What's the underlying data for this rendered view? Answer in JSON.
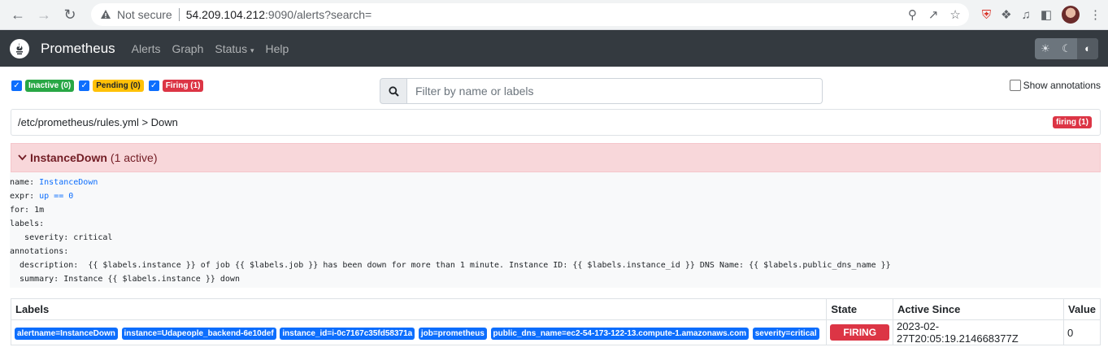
{
  "browser": {
    "security_text": "Not secure",
    "url_host": "54.209.104.212",
    "url_path": ":9090/alerts?search="
  },
  "navbar": {
    "brand": "Prometheus",
    "links": [
      "Alerts",
      "Graph",
      "Status",
      "Help"
    ]
  },
  "filters": {
    "inactive": "Inactive (0)",
    "pending": "Pending (0)",
    "firing": "Firing (1)",
    "search_placeholder": "Filter by name or labels",
    "show_annotations": "Show annotations"
  },
  "rule_file": {
    "path": "/etc/prometheus/rules.yml > Down",
    "badge": "firing (1)"
  },
  "alert_group": {
    "name": "InstanceDown",
    "count": "(1 active)",
    "definition": {
      "name_key": "name: ",
      "name_val": "InstanceDown",
      "expr_key": "expr: ",
      "expr_val": "up == 0",
      "for_line": "for: 1m",
      "labels_line": "labels:",
      "severity_line": "   severity: critical",
      "annotations_line": "annotations:",
      "description_line": "  description:  {{ $labels.instance }} of job {{ $labels.job }} has been down for more than 1 minute. Instance ID: {{ $labels.instance_id }} DNS Name: {{ $labels.public_dns_name }}",
      "summary_line": "  summary: Instance {{ $labels.instance }} down"
    }
  },
  "table": {
    "headers": [
      "Labels",
      "State",
      "Active Since",
      "Value"
    ],
    "row": {
      "labels": [
        "alertname=InstanceDown",
        "instance=Udapeople_backend-6e10def",
        "instance_id=i-0c7167c35fd58371a",
        "job=prometheus",
        "public_dns_name=ec2-54-173-122-13.compute-1.amazonaws.com",
        "severity=critical"
      ],
      "state": "FIRING",
      "active_since": "2023-02-27T20:05:19.214668377Z",
      "value": "0"
    }
  }
}
